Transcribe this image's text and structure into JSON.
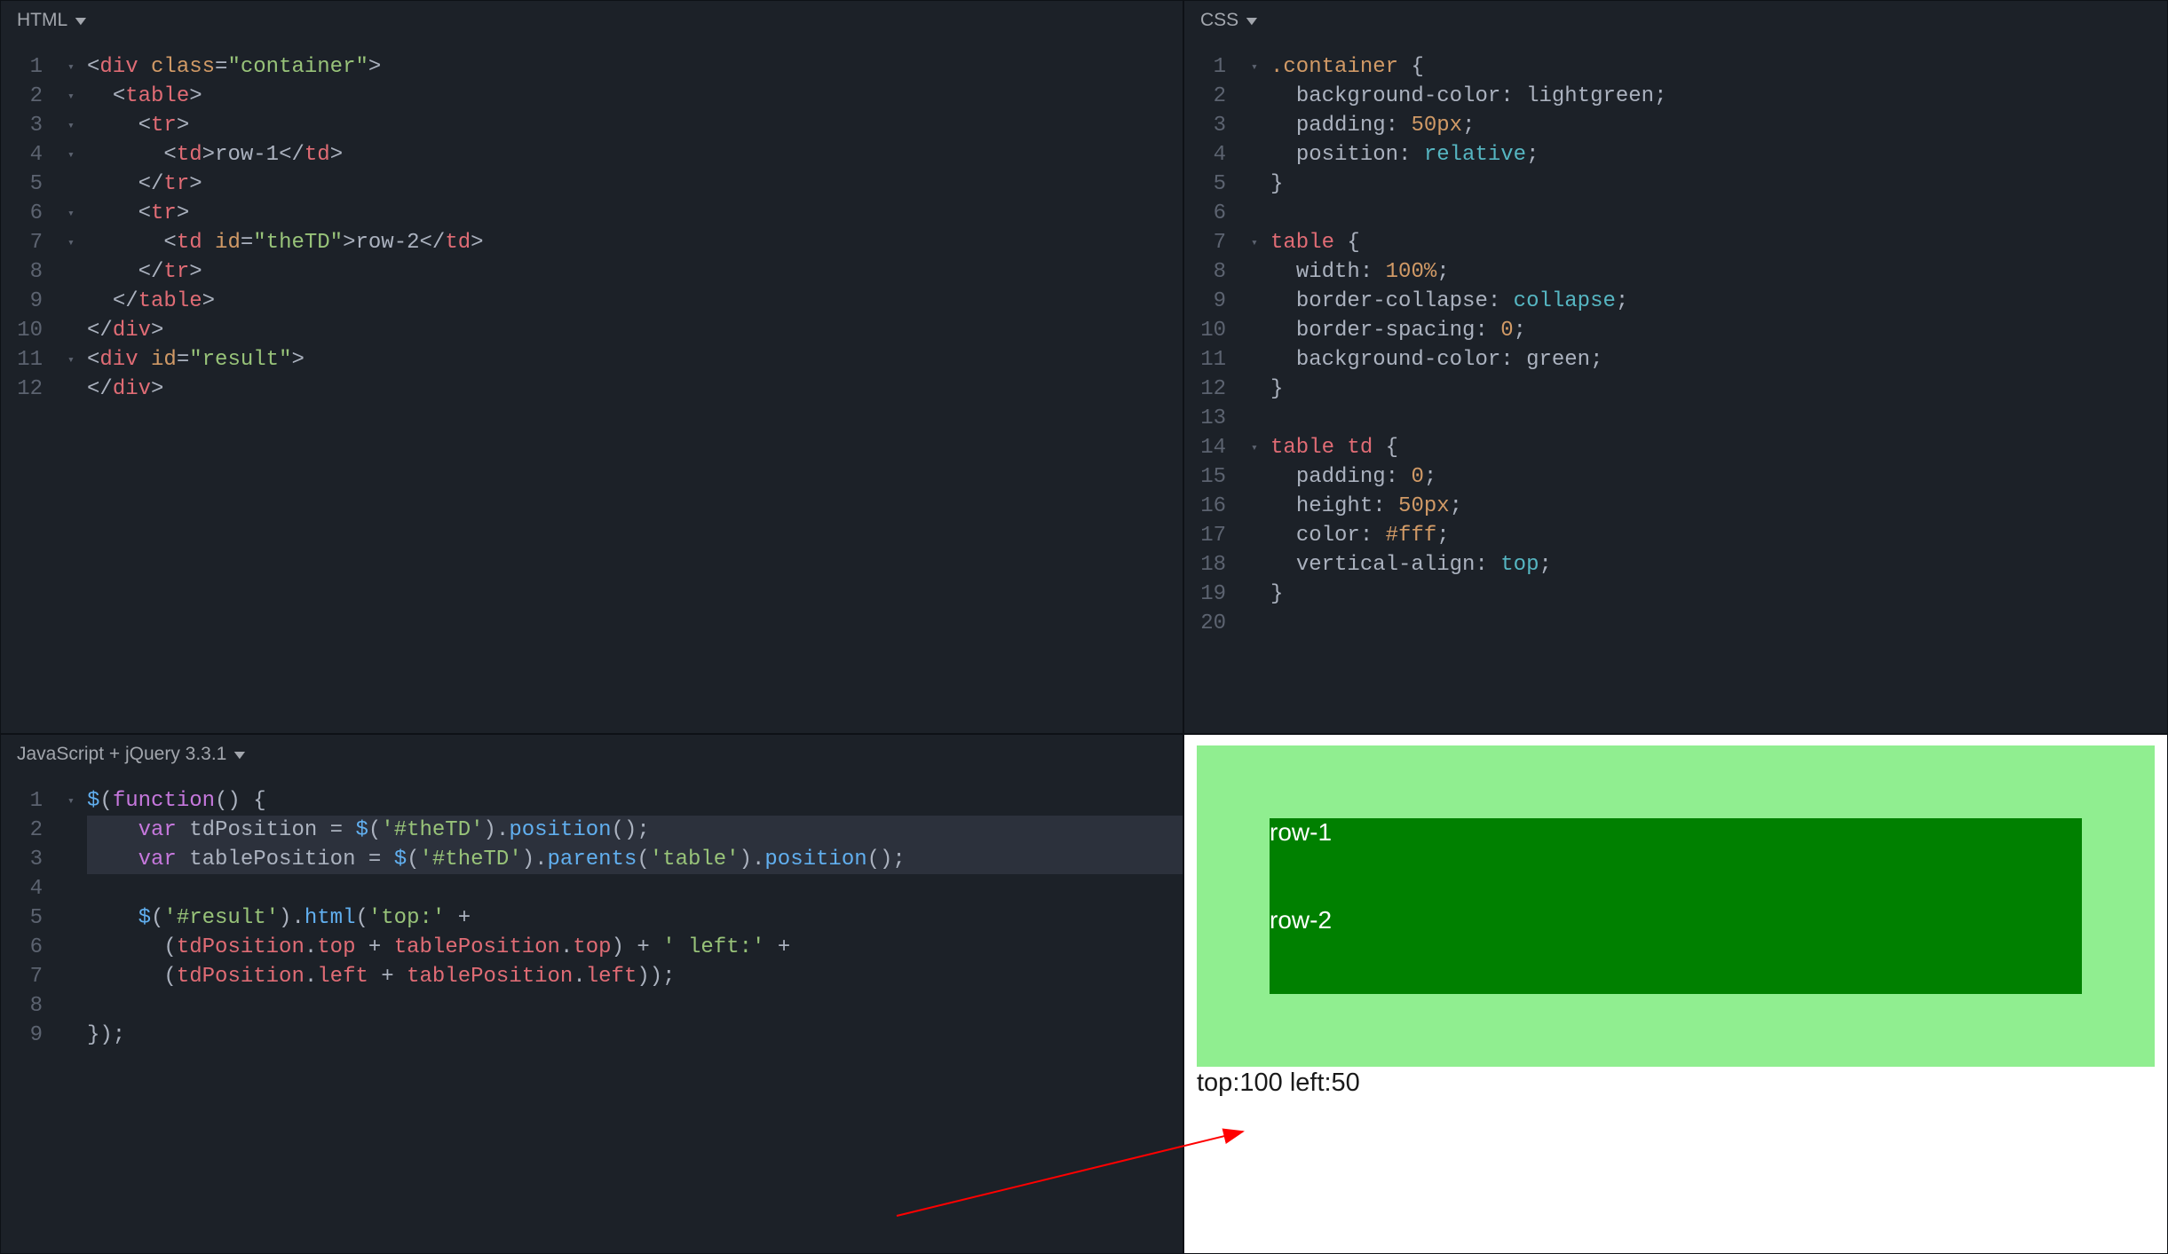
{
  "panes": {
    "html": {
      "title": "HTML"
    },
    "css": {
      "title": "CSS"
    },
    "js": {
      "title": "JavaScript + jQuery 3.3.1"
    }
  },
  "html_code": {
    "lines": [
      {
        "n": 1,
        "fold": "▾",
        "html": "<span class='punct'>&lt;</span><span class='tag'>div</span> <span class='attr'>class</span><span class='punct'>=</span><span class='str'>\"container\"</span><span class='punct'>&gt;</span>"
      },
      {
        "n": 2,
        "fold": "▾",
        "html": "  <span class='punct'>&lt;</span><span class='tag'>table</span><span class='punct'>&gt;</span>"
      },
      {
        "n": 3,
        "fold": "▾",
        "html": "    <span class='punct'>&lt;</span><span class='tag'>tr</span><span class='punct'>&gt;</span>"
      },
      {
        "n": 4,
        "fold": "▾",
        "html": "      <span class='punct'>&lt;</span><span class='tag'>td</span><span class='punct'>&gt;</span><span class='plain'>row-1</span><span class='punct'>&lt;/</span><span class='tag'>td</span><span class='punct'>&gt;</span>"
      },
      {
        "n": 5,
        "fold": "",
        "html": "    <span class='punct'>&lt;/</span><span class='tag'>tr</span><span class='punct'>&gt;</span>"
      },
      {
        "n": 6,
        "fold": "▾",
        "html": "    <span class='punct'>&lt;</span><span class='tag'>tr</span><span class='punct'>&gt;</span>"
      },
      {
        "n": 7,
        "fold": "▾",
        "html": "      <span class='punct'>&lt;</span><span class='tag'>td</span> <span class='attr'>id</span><span class='punct'>=</span><span class='str'>\"theTD\"</span><span class='punct'>&gt;</span><span class='plain'>row-2</span><span class='punct'>&lt;/</span><span class='tag'>td</span><span class='punct'>&gt;</span>"
      },
      {
        "n": 8,
        "fold": "",
        "html": "    <span class='punct'>&lt;/</span><span class='tag'>tr</span><span class='punct'>&gt;</span>"
      },
      {
        "n": 9,
        "fold": "",
        "html": "  <span class='punct'>&lt;/</span><span class='tag'>table</span><span class='punct'>&gt;</span>"
      },
      {
        "n": 10,
        "fold": "",
        "html": "<span class='punct'>&lt;/</span><span class='tag'>div</span><span class='punct'>&gt;</span>"
      },
      {
        "n": 11,
        "fold": "▾",
        "html": "<span class='punct'>&lt;</span><span class='tag'>div</span> <span class='attr'>id</span><span class='punct'>=</span><span class='str'>\"result\"</span><span class='punct'>&gt;</span>"
      },
      {
        "n": 12,
        "fold": "",
        "html": "<span class='punct'>&lt;/</span><span class='tag'>div</span><span class='punct'>&gt;</span>"
      }
    ]
  },
  "css_code": {
    "lines": [
      {
        "n": 1,
        "fold": "▾",
        "html": "<span class='sel'>.container</span> <span class='punct'>{</span>"
      },
      {
        "n": 2,
        "fold": "",
        "html": "  <span class='plain'>background-color</span><span class='punct'>:</span> <span class='plain'>lightgreen</span><span class='punct'>;</span>"
      },
      {
        "n": 3,
        "fold": "",
        "html": "  <span class='plain'>padding</span><span class='punct'>:</span> <span class='num'>50px</span><span class='punct'>;</span>"
      },
      {
        "n": 4,
        "fold": "",
        "html": "  <span class='plain'>position</span><span class='punct'>:</span> <span class='propkey'>relative</span><span class='punct'>;</span>"
      },
      {
        "n": 5,
        "fold": "",
        "html": "<span class='punct'>}</span>"
      },
      {
        "n": 6,
        "fold": "",
        "html": ""
      },
      {
        "n": 7,
        "fold": "▾",
        "html": "<span class='selred'>table</span> <span class='punct'>{</span>"
      },
      {
        "n": 8,
        "fold": "",
        "html": "  <span class='plain'>width</span><span class='punct'>:</span> <span class='num'>100%</span><span class='punct'>;</span>"
      },
      {
        "n": 9,
        "fold": "",
        "html": "  <span class='plain'>border-collapse</span><span class='punct'>:</span> <span class='propkey'>collapse</span><span class='punct'>;</span>"
      },
      {
        "n": 10,
        "fold": "",
        "html": "  <span class='plain'>border-spacing</span><span class='punct'>:</span> <span class='num'>0</span><span class='punct'>;</span>"
      },
      {
        "n": 11,
        "fold": "",
        "html": "  <span class='plain'>background-color</span><span class='punct'>:</span> <span class='plain'>green</span><span class='punct'>;</span>"
      },
      {
        "n": 12,
        "fold": "",
        "html": "<span class='punct'>}</span>"
      },
      {
        "n": 13,
        "fold": "",
        "html": ""
      },
      {
        "n": 14,
        "fold": "▾",
        "html": "<span class='selred'>table</span> <span class='selred'>td</span> <span class='punct'>{</span>"
      },
      {
        "n": 15,
        "fold": "",
        "html": "  <span class='plain'>padding</span><span class='punct'>:</span> <span class='num'>0</span><span class='punct'>;</span>"
      },
      {
        "n": 16,
        "fold": "",
        "html": "  <span class='plain'>height</span><span class='punct'>:</span> <span class='num'>50px</span><span class='punct'>;</span>"
      },
      {
        "n": 17,
        "fold": "",
        "html": "  <span class='plain'>color</span><span class='punct'>:</span> <span class='num'>#fff</span><span class='punct'>;</span>"
      },
      {
        "n": 18,
        "fold": "",
        "html": "  <span class='plain'>vertical-align</span><span class='punct'>:</span> <span class='propkey'>top</span><span class='punct'>;</span>"
      },
      {
        "n": 19,
        "fold": "",
        "html": "<span class='punct'>}</span>"
      },
      {
        "n": 20,
        "fold": "",
        "html": ""
      }
    ]
  },
  "js_code": {
    "lines": [
      {
        "n": 1,
        "fold": "▾",
        "hl": false,
        "html": "<span class='varblue'>$</span><span class='paren'>(</span><span class='kw'>function</span><span class='paren'>() {</span>"
      },
      {
        "n": 2,
        "fold": "",
        "hl": true,
        "html": "    <span class='decl'>var</span> <span class='plain'>tdPosition</span> <span class='punct'>=</span> <span class='varblue'>$</span><span class='paren'>(</span><span class='str'>'#theTD'</span><span class='paren'>)</span><span class='dot'>.</span><span class='method'>position</span><span class='paren'>();</span>"
      },
      {
        "n": 3,
        "fold": "",
        "hl": true,
        "html": "    <span class='decl'>var</span> <span class='plain'>tablePosition</span> <span class='punct'>=</span> <span class='varblue'>$</span><span class='paren'>(</span><span class='str'>'#theTD'</span><span class='paren'>)</span><span class='dot'>.</span><span class='method'>parents</span><span class='paren'>(</span><span class='str'>'table'</span><span class='paren'>)</span><span class='dot'>.</span><span class='method'>position</span><span class='paren'>();</span>"
      },
      {
        "n": 4,
        "fold": "",
        "hl": false,
        "html": ""
      },
      {
        "n": 5,
        "fold": "",
        "hl": false,
        "html": "    <span class='varblue'>$</span><span class='paren'>(</span><span class='str'>'#result'</span><span class='paren'>)</span><span class='dot'>.</span><span class='method'>html</span><span class='paren'>(</span><span class='str'>'top:'</span> <span class='punct'>+</span>"
      },
      {
        "n": 6,
        "fold": "",
        "hl": false,
        "html": "      <span class='paren'>(</span><span class='ident'>tdPosition</span><span class='dot'>.</span><span class='ident'>top</span> <span class='punct'>+</span> <span class='ident'>tablePosition</span><span class='dot'>.</span><span class='ident'>top</span><span class='paren'>)</span> <span class='punct'>+</span> <span class='str'>' left:'</span> <span class='punct'>+</span>"
      },
      {
        "n": 7,
        "fold": "",
        "hl": false,
        "html": "      <span class='paren'>(</span><span class='ident'>tdPosition</span><span class='dot'>.</span><span class='ident'>left</span> <span class='punct'>+</span> <span class='ident'>tablePosition</span><span class='dot'>.</span><span class='ident'>left</span><span class='paren'>));</span>"
      },
      {
        "n": 8,
        "fold": "",
        "hl": false,
        "html": ""
      },
      {
        "n": 9,
        "fold": "",
        "hl": false,
        "html": "<span class='paren'>});</span>"
      }
    ]
  },
  "preview": {
    "row1": "row-1",
    "row2": "row-2",
    "result": "top:100 left:50"
  }
}
